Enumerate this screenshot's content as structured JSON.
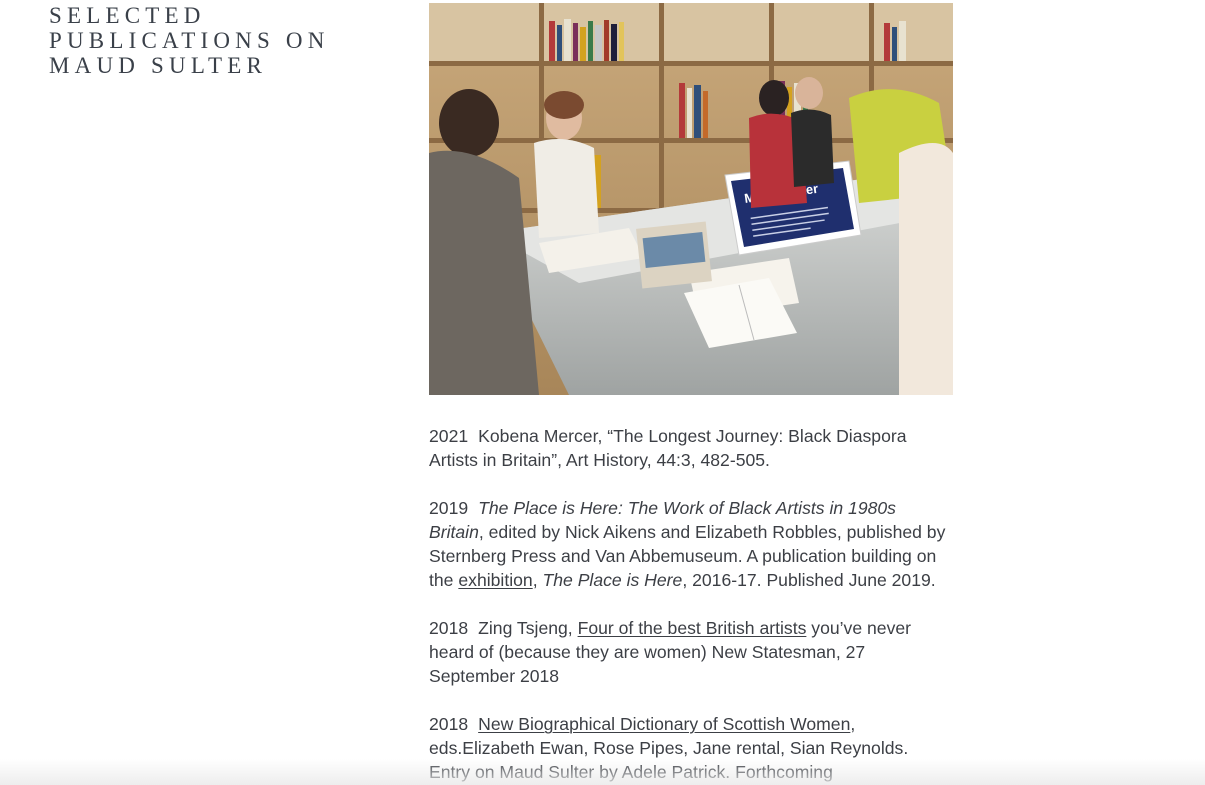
{
  "heading": "Selected Publications on Maud Sulter",
  "photo": {
    "icon": "photo-library-display",
    "sign_title": "Maud Sulter"
  },
  "entries": [
    {
      "year": "2021",
      "author": "Kobena Mercer,",
      "title": "“The Longest Journey: Black Diaspora Artists in Britain”,",
      "rest": "Art History, 44:3, 482-505."
    },
    {
      "year": "2019",
      "title_italic": "The Place is Here: The Work of Black Artists in 1980s Britain",
      "mid": ", edited by Nick Aikens and Elizabeth Robbles, published by Sternberg Press and Van Abbemuseum. A publication building on the",
      "link": "exhibition",
      "comma": ",",
      "title_italic_2": "The Place is Here",
      "end": ", 2016-17. Published June 2019."
    },
    {
      "year": "2018",
      "author": "Zing Tsjeng,",
      "link": "Four of the best British artists",
      "rest": "you’ve never heard of (because they are women) New Statesman, 27 September 2018"
    },
    {
      "year": "2018",
      "link": "New Biographical Dictionary of Scottish Women",
      "rest": ", eds.Elizabeth Ewan, Rose Pipes, Jane rental, Sian Reynolds. Entry on Maud Sulter by Adele Patrick. Forthcoming"
    }
  ],
  "colors": {
    "text": "#3c3f45",
    "heading": "#3a4049",
    "background": "#ffffff"
  }
}
